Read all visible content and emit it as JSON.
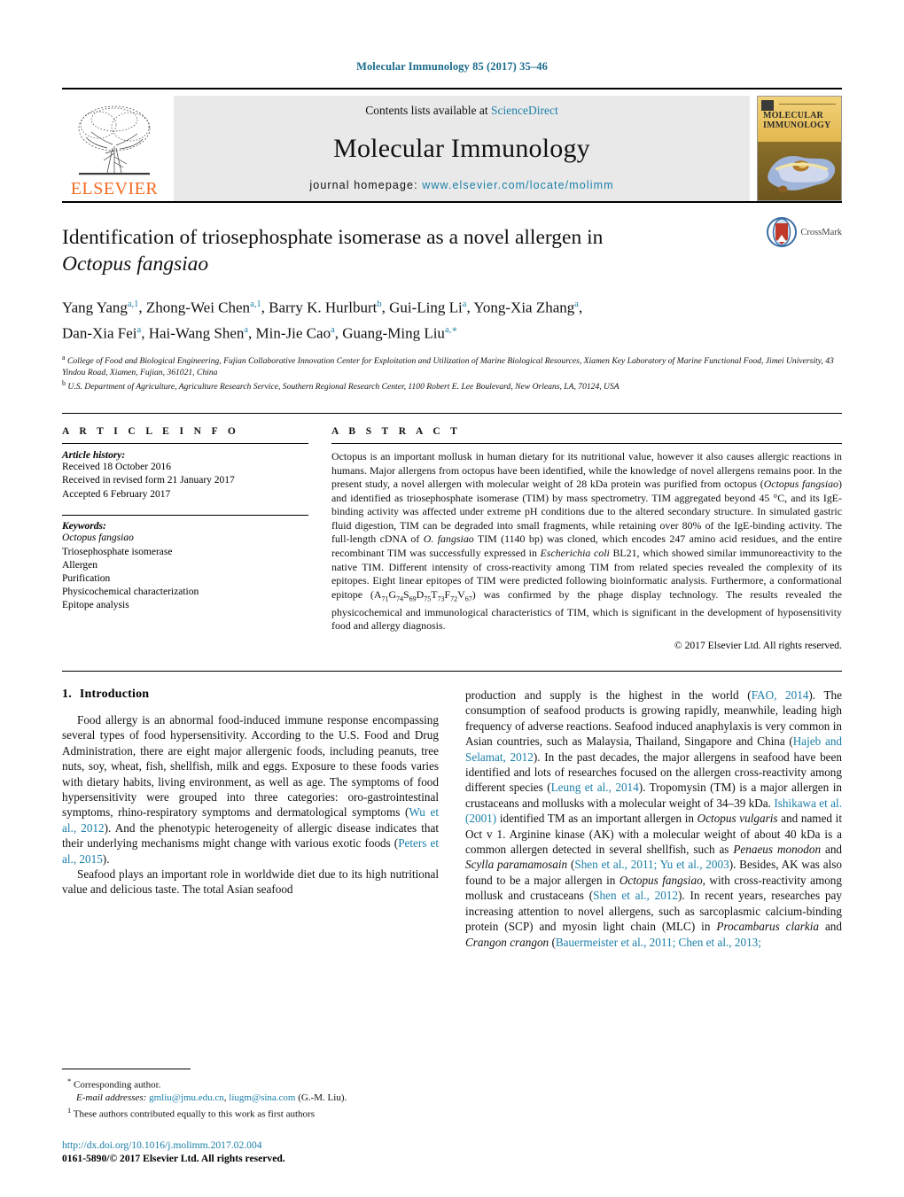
{
  "running_head": "Molecular Immunology 85 (2017) 35–46",
  "masthead": {
    "publisher_logo_text": "ELSEVIER",
    "contents_prefix": "Contents lists available at ",
    "contents_link": "ScienceDirect",
    "journal_title": "Molecular Immunology",
    "homepage_prefix": "journal homepage: ",
    "homepage_url": "www.elsevier.com/locate/molimm",
    "cover_title_line1": "MOLECULAR",
    "cover_title_line2": "IMMUNOLOGY"
  },
  "article": {
    "title_main": "Identification of triosephosphate isomerase as a novel allergen in",
    "title_italic": "Octopus fangsiao",
    "crossmark_label": "CrossMark",
    "authors_line1": "Yang Yang<sup>a,1</sup>, Zhong-Wei Chen<sup>a,1</sup>, Barry K. Hurlburt<sup>b</sup>, Gui-Ling Li<sup>a</sup>, Yong-Xia Zhang<sup>a</sup>,",
    "authors_line2": "Dan-Xia Fei<sup>a</sup>, Hai-Wang Shen<sup>a</sup>, Min-Jie Cao<sup>a</sup>, Guang-Ming Liu<sup>a,∗</sup>",
    "affiliation_a": "<sup>a</sup> College of Food and Biological Engineering, Fujian Collaborative Innovation Center for Exploitation and Utilization of Marine Biological Resources, Xiamen Key Laboratory of Marine Functional Food, Jimei University, 43 Yindou Road, Xiamen, Fujian, 361021, China",
    "affiliation_b": "<sup>b</sup> U.S. Department of Agriculture, Agriculture Research Service, Southern Regional Research Center, 1100 Robert E. Lee Boulevard, New Orleans, LA, 70124, USA"
  },
  "article_info": {
    "heading": "A R T I C L E   I N F O",
    "history_label": "Article history:",
    "history": [
      "Received 18 October 2016",
      "Received in revised form 21 January 2017",
      "Accepted 6 February 2017"
    ],
    "keywords_label": "Keywords:",
    "keywords": [
      "Octopus fangsiao",
      "Triosephosphate isomerase",
      "Allergen",
      "Purification",
      "Physicochemical characterization",
      "Epitope analysis"
    ]
  },
  "abstract": {
    "heading": "A B S T R A C T",
    "text_html": "Octopus is an important mollusk in human dietary for its nutritional value, however it also causes allergic reactions in humans. Major allergens from octopus have been identified, while the knowledge of novel allergens remains poor. In the present study, a novel allergen with molecular weight of 28 kDa protein was purified from octopus (<span class=\"ital\">Octopus fangsiao</span>) and identified as triosephosphate isomerase (TIM) by mass spectrometry. TIM aggregated beyond 45 °C, and its IgE-binding activity was affected under extreme pH conditions due to the altered secondary structure. In simulated gastric fluid digestion, TIM can be degraded into small fragments, while retaining over 80% of the IgE-binding activity. The full-length cDNA of <span class=\"ital\">O. fangsiao</span> TIM (1140 bp) was cloned, which encodes 247 amino acid residues, and the entire recombinant TIM was successfully expressed in <span class=\"ital\">Escherichia coli</span> BL21, which showed similar immunoreactivity to the native TIM. Different intensity of cross-reactivity among TIM from related species revealed the complexity of its epitopes. Eight linear epitopes of TIM were predicted following bioinformatic analysis. Furthermore, a conformational epitope (A<sub>71</sub>G<sub>74</sub>S<sub>69</sub>D<sub>75</sub>T<sub>73</sub>F<sub>72</sub>V<sub>67</sub>) was confirmed by the phage display technology. The results revealed the physicochemical and immunological characteristics of TIM, which is significant in the development of hyposensitivity food and allergy diagnosis.",
    "copyright": "© 2017 Elsevier Ltd. All rights reserved."
  },
  "intro": {
    "heading_number": "1.",
    "heading_text": "Introduction",
    "left_para_1_html": "Food allergy is an abnormal food-induced immune response encompassing several types of food hypersensitivity. According to the U.S. Food and Drug Administration, there are eight major allergenic foods, including peanuts, tree nuts, soy, wheat, fish, shellfish, milk and eggs. Exposure to these foods varies with dietary habits, living environment, as well as age. The symptoms of food hypersensitivity were grouped into three categories: oro-gastrointestinal symptoms, rhino-respiratory symptoms and dermatological symptoms (<span class=\"ref\">Wu et al., 2012</span>). And the phenotypic heterogeneity of allergic disease indicates that their underlying mechanisms might change with various exotic foods (<span class=\"ref\">Peters et al., 2015</span>).",
    "left_para_2_html": "Seafood plays an important role in worldwide diet due to its high nutritional value and delicious taste. The total Asian seafood",
    "right_para_1_html": "production and supply is the highest in the world (<span class=\"ref\">FAO, 2014</span>). The consumption of seafood products is growing rapidly, meanwhile, leading high frequency of adverse reactions. Seafood induced anaphylaxis is very common in Asian countries, such as Malaysia, Thailand, Singapore and China (<span class=\"ref\">Hajeb and Selamat, 2012</span>). In the past decades, the major allergens in seafood have been identified and lots of researches focused on the allergen cross-reactivity among different species (<span class=\"ref\">Leung et al., 2014</span>). Tropomysin (TM) is a major allergen in crustaceans and mollusks with a molecular weight of 34–39 kDa. <span class=\"ref\">Ishikawa et al. (2001)</span> identified TM as an important allergen in <span class=\"ital\">Octopus vulgaris</span> and named it Oct v 1. Arginine kinase (AK) with a molecular weight of about 40 kDa is a common allergen detected in several shellfish, such as <span class=\"ital\">Penaeus monodon</span> and <span class=\"ital\">Scylla paramamosain</span> (<span class=\"ref\">Shen et al., 2011; Yu et al., 2003</span>). Besides, AK was also found to be a major allergen in <span class=\"ital\">Octopus fangsiao</span>, with cross-reactivity among mollusk and crustaceans (<span class=\"ref\">Shen et al., 2012</span>). In recent years, researches pay increasing attention to novel allergens, such as sarcoplasmic calcium-binding protein (SCP) and myosin light chain (MLC) in <span class=\"ital\">Procambarus clarkia</span> and <span class=\"ital\">Crangon crangon</span> (<span class=\"ref\">Bauermeister et al., 2011; Chen et al., 2013;</span>"
  },
  "footnotes": {
    "corresponding_html": "<sup>*</sup> Corresponding author.",
    "email_html": "<span class=\"em\">E-mail addresses:</span> <span class=\"mail\">gmliu@jmu.edu.cn</span>, <span class=\"mail\">liugm@sina.com</span> (G.-M. Liu).",
    "equal_contrib_html": "<sup>1</sup> These authors contributed equally to this work as first authors",
    "doi": "http://dx.doi.org/10.1016/j.molimm.2017.02.004",
    "issn_line": "0161-5890/© 2017 Elsevier Ltd. All rights reserved."
  },
  "colors": {
    "link": "#1b7fa8",
    "running_head": "#1b6c8c",
    "elsevier_orange": "#f36b21"
  }
}
